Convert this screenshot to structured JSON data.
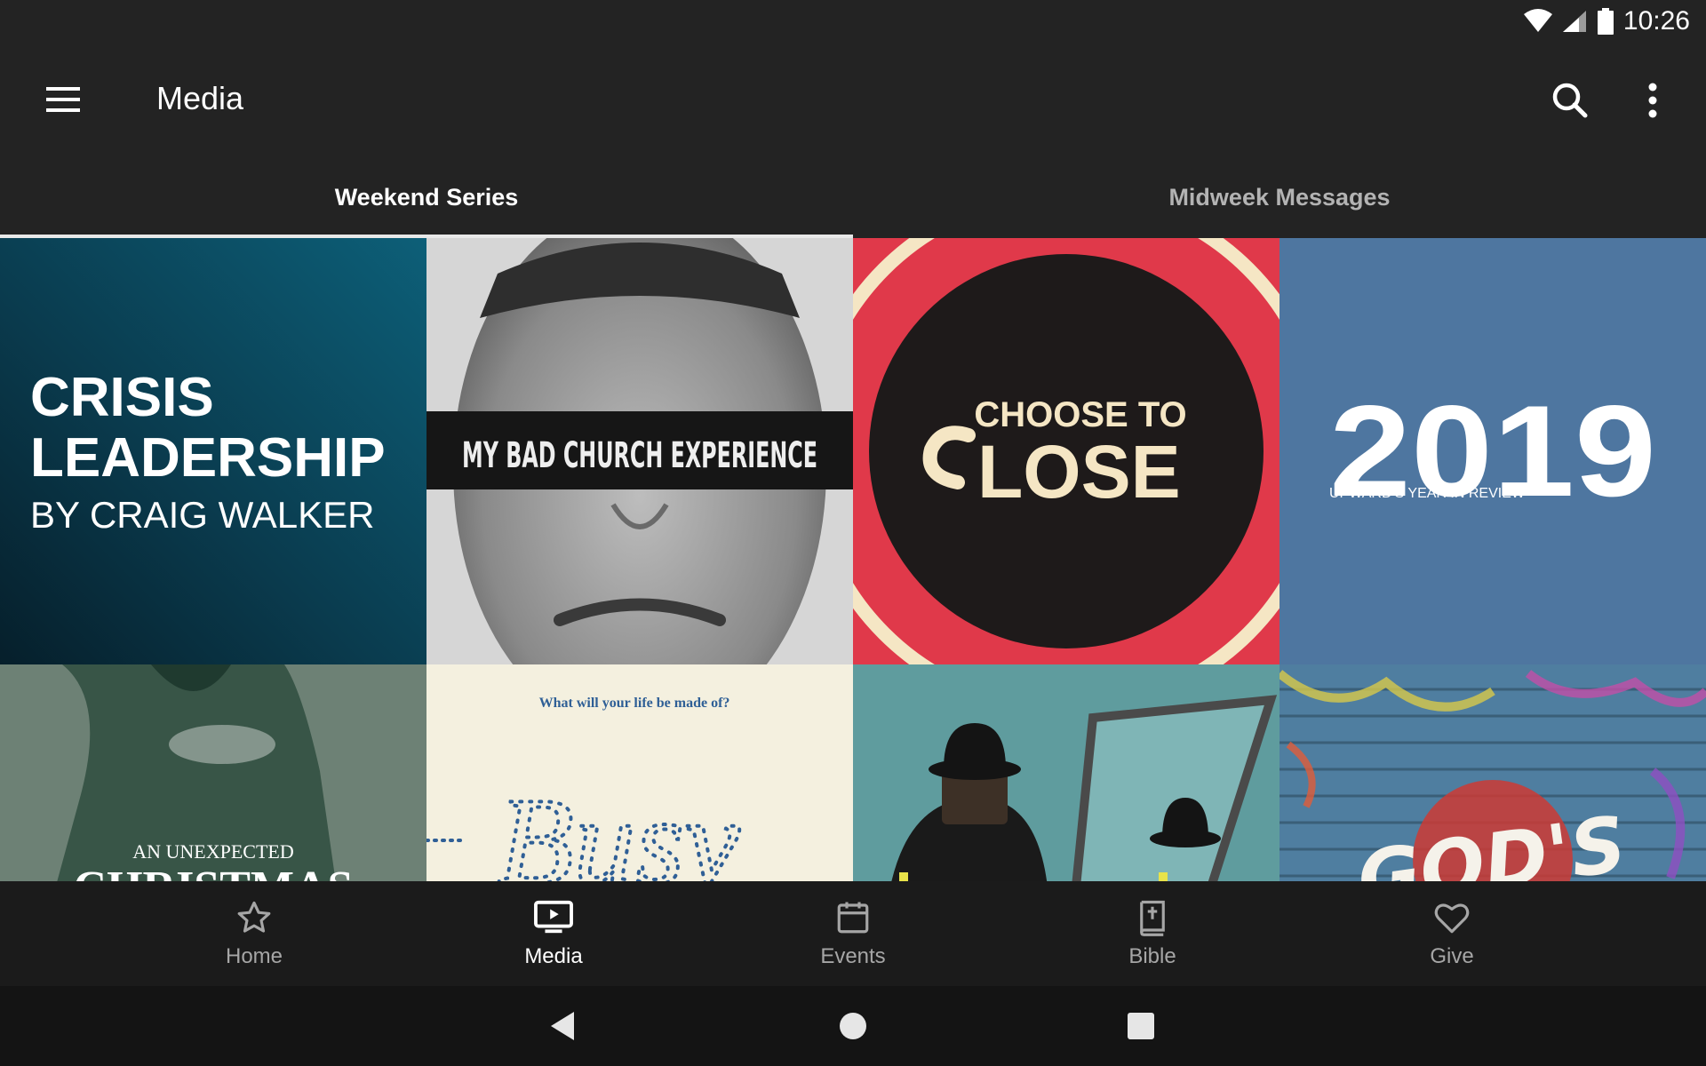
{
  "status_bar": {
    "time": "10:26",
    "icons": [
      "wifi-icon",
      "signal-icon",
      "battery-icon"
    ]
  },
  "app_bar": {
    "title": "Media",
    "icons": [
      "menu-icon",
      "search-icon",
      "more-vert-icon"
    ]
  },
  "tabs": [
    {
      "label": "Weekend Series",
      "active": true
    },
    {
      "label": "Midweek Messages",
      "active": false
    }
  ],
  "series": [
    {
      "line1": "CRISIS",
      "line2": "LEADERSHIP",
      "line3": "BY CRAIG WALKER"
    },
    {
      "text": "MY BAD CHURCH EXPERIENCE"
    },
    {
      "line1": "CHOOSE TO",
      "line2": "LOSE"
    },
    {
      "year": "2019",
      "subtitle": "UPWARD'S YEAR IN REVIEW"
    },
    {
      "line1": "AN UNEXPECTED",
      "line2": "CHRISTMAS"
    },
    {
      "tagline": "What will your life be made of?",
      "word": "Busy"
    },
    {
      "text": ""
    },
    {
      "word": "GOD'S"
    }
  ],
  "bottom_nav": [
    {
      "label": "Home",
      "icon": "star-icon",
      "active": false
    },
    {
      "label": "Media",
      "icon": "tv-icon",
      "active": true
    },
    {
      "label": "Events",
      "icon": "calendar-icon",
      "active": false
    },
    {
      "label": "Bible",
      "icon": "bible-icon",
      "active": false
    },
    {
      "label": "Give",
      "icon": "heart-icon",
      "active": false
    }
  ],
  "system_nav": [
    "back-icon",
    "home-circle-icon",
    "recents-icon"
  ],
  "colors": {
    "background": "#232323",
    "bottom_nav": "#1b1b1b",
    "system_nav": "#141414",
    "tab_indicator": "#e8e8e8"
  }
}
